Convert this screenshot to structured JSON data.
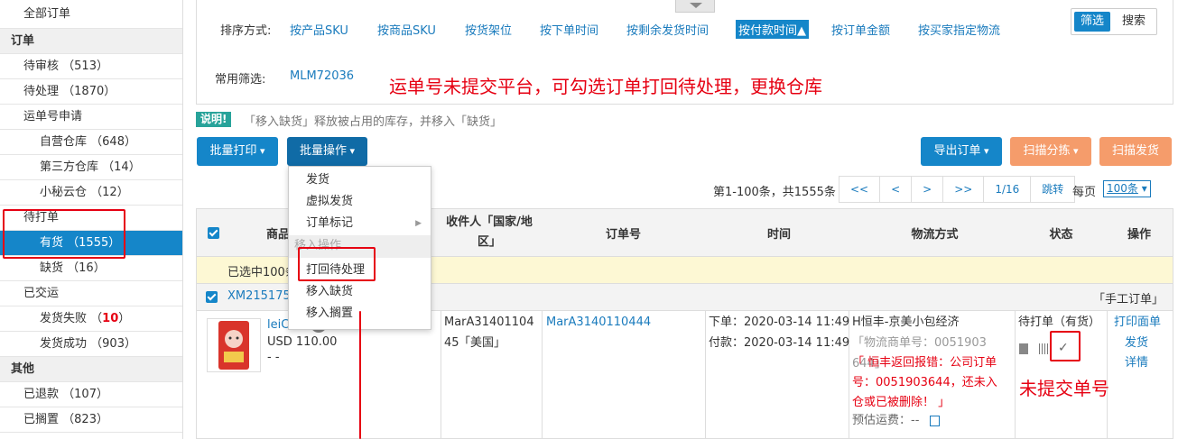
{
  "sidebar": {
    "items": [
      {
        "label": "全部订单",
        "count": ""
      },
      {
        "label": "订单",
        "count": ""
      },
      {
        "label": "待审核",
        "count": "（513）"
      },
      {
        "label": "待处理",
        "count": "（1870）"
      },
      {
        "label": "运单号申请",
        "count": ""
      },
      {
        "label": "自营仓库",
        "count": "（648）"
      },
      {
        "label": "第三方仓库",
        "count": "（14）"
      },
      {
        "label": "小秘云仓",
        "count": "（12）"
      },
      {
        "label": "待打单",
        "count": ""
      },
      {
        "label": "有货",
        "count": "（1555）"
      },
      {
        "label": "缺货",
        "count": "（16）"
      },
      {
        "label": "已交运",
        "count": ""
      },
      {
        "label": "发货失败",
        "count": "10"
      },
      {
        "label": "发货成功",
        "count": "（903）"
      },
      {
        "label": "其他",
        "count": ""
      },
      {
        "label": "已退款",
        "count": "（107）"
      },
      {
        "label": "已搁置",
        "count": "（823）"
      }
    ]
  },
  "sort": {
    "label": "排序方式:",
    "options": [
      "按产品SKU",
      "按商品SKU",
      "按货架位",
      "按下单时间",
      "按剩余发货时间",
      "按付款时间▲",
      "按订单金额",
      "按买家指定物流"
    ],
    "active_index": 5
  },
  "toggle": {
    "filter": "筛选",
    "search": "搜索"
  },
  "common_filter": {
    "label": "常用筛选:",
    "value": "MLM72036"
  },
  "annotations": {
    "top": "运单号未提交平台，可勾选订单打回待处理，更换仓库",
    "status": "未提交单号"
  },
  "notice": {
    "badge": "说明!",
    "text": "「移入缺货」释放被占用的库存，并移入「缺货」"
  },
  "toolbar": {
    "batch_print": "批量打印",
    "batch_ops": "批量操作",
    "export": "导出订单",
    "scan_sort": "扫描分拣",
    "scan_ship": "扫描发货"
  },
  "pagination": {
    "summary": "第1-100条，共1555条",
    "first": "<<",
    "prev": "<",
    "next": ">",
    "last": ">>",
    "page": "1/16",
    "jump": "跳转",
    "per_page_label": "每页",
    "per_page_value": "100条"
  },
  "menu": {
    "items": [
      "发货",
      "虚拟发货",
      "订单标记",
      "移入操作",
      "打回待处理",
      "移入缺货",
      "移入搁置"
    ]
  },
  "table": {
    "headers": [
      "商品",
      "收件人「国家/地区」",
      "订单号",
      "时间",
      "物流方式",
      "状态",
      "操作"
    ],
    "selected_text": "已选中100条",
    "order_id": "XM2151754",
    "order_tag": "「手工订单」",
    "row": {
      "product_name": "leiC",
      "price": "USD 110.00",
      "dash": "- -",
      "recipient": "MarA3140110445",
      "country": "「美国」",
      "order_no": "MarA3140110444",
      "order_time": "下单：2020-03-14 11:49",
      "pay_time": "付款：2020-03-14 11:49",
      "logistics": "H恒丰-京美小包经济",
      "logistics_no": "「物流商单号：0051903644」",
      "error": "「 恒丰返回报错：公司订单号：0051903644，还未入仓或已被删除！ 」",
      "freight": "预估运费：--",
      "status": "待打单（有货）",
      "actions": [
        "打印面单",
        "发货",
        "详情"
      ]
    }
  },
  "colors": {
    "primary": "#1586c9",
    "orange": "#f59c6b",
    "red": "#e60012",
    "teal": "#28a39a"
  }
}
